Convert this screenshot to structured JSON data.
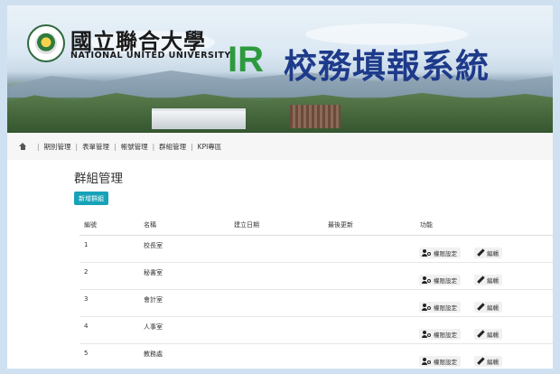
{
  "banner": {
    "university_cn": "國立聯合大學",
    "university_en": "NATIONAL UNITED UNIVERSITY",
    "system_prefix": "IR",
    "system_name": "校務填報系統"
  },
  "nav": {
    "items": [
      "期別管理",
      "表單管理",
      "帳號管理",
      "群組管理",
      "KPI專區"
    ],
    "separator": "|"
  },
  "page": {
    "title": "群組管理",
    "add_button": "新增群組"
  },
  "table": {
    "headers": {
      "id": "編號",
      "name": "名稱",
      "created": "建立日期",
      "updated": "最後更新",
      "functions": "功能"
    },
    "rows": [
      {
        "id": "1",
        "name": "校長室",
        "created": "",
        "updated": ""
      },
      {
        "id": "2",
        "name": "秘書室",
        "created": "",
        "updated": ""
      },
      {
        "id": "3",
        "name": "會計室",
        "created": "",
        "updated": ""
      },
      {
        "id": "4",
        "name": "人事室",
        "created": "",
        "updated": ""
      },
      {
        "id": "5",
        "name": "教務處",
        "created": "",
        "updated": ""
      }
    ],
    "perm_label": "權限設定",
    "edit_label": "編輯"
  },
  "colors": {
    "accent": "#17a2b8",
    "title_blue": "#1e3a8a",
    "ir_green": "#2e9a3e",
    "outer_bg": "#cfe1f1"
  },
  "icons": [
    "home-icon",
    "user-gear-icon",
    "pencil-icon"
  ]
}
